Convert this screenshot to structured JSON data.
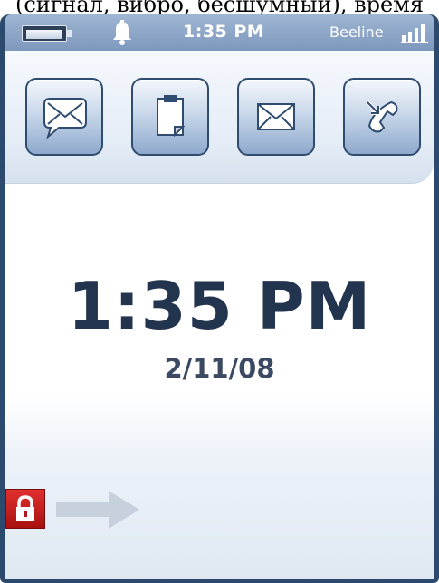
{
  "caption": "(сигнал, вибро, бесшумный), время",
  "status_bar": {
    "battery_icon": "battery-icon",
    "notification_icon": "bell-icon",
    "time": "1:35 PM",
    "carrier": "Beeline",
    "signal_icon": "signal-bars-icon"
  },
  "tray": {
    "tiles": [
      {
        "name": "text-message-tile",
        "icon": "speech-bubble-envelope-icon"
      },
      {
        "name": "tasks-tile",
        "icon": "clipboard-icon"
      },
      {
        "name": "email-tile",
        "icon": "envelope-icon"
      },
      {
        "name": "missed-calls-tile",
        "icon": "phone-arrow-icon"
      }
    ]
  },
  "clock": {
    "time": "1:35 PM",
    "date": "2/11/08"
  },
  "lock": {
    "icon": "padlock-icon",
    "slider_icon": "arrow-right-icon"
  },
  "colors": {
    "accent_dark": "#23344f",
    "lock_red": "#c41e1d",
    "frame": "#2c4a6e"
  }
}
